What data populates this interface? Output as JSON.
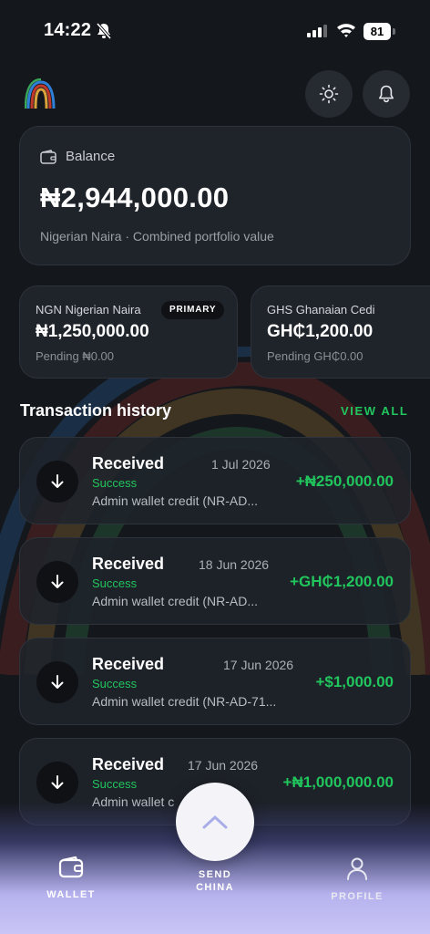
{
  "status_bar": {
    "time": "14:22",
    "battery": "81"
  },
  "balance": {
    "label": "Balance",
    "amount": "₦2,944,000.00",
    "subtitle": "Nigerian Naira · Combined portfolio value"
  },
  "currencies": [
    {
      "name": "NGN Nigerian Naira",
      "badge": "PRIMARY",
      "amount": "₦1,250,000.00",
      "pending": "Pending ₦0.00"
    },
    {
      "name": "GHS Ghanaian Cedi",
      "amount": "GH₵1,200.00",
      "pending": "Pending GH₵0.00"
    }
  ],
  "transactions_header": {
    "title": "Transaction history",
    "view_all": "VIEW ALL"
  },
  "transactions": [
    {
      "type": "Received",
      "date": "1 Jul 2026",
      "status": "Success",
      "description": "Admin wallet credit (NR-AD...",
      "amount": "+₦250,000.00"
    },
    {
      "type": "Received",
      "date": "18 Jun 2026",
      "status": "Success",
      "description": "Admin wallet credit (NR-AD...",
      "amount": "+GH₵1,200.00"
    },
    {
      "type": "Received",
      "date": "17 Jun 2026",
      "status": "Success",
      "description": "Admin wallet credit (NR-AD-71...",
      "amount": "+$1,000.00"
    },
    {
      "type": "Received",
      "date": "17 Jun 2026",
      "status": "Success",
      "description": "Admin wallet c",
      "amount": "+₦1,000,000.00"
    }
  ],
  "bottom_nav": {
    "wallet": "WALLET",
    "send": "SEND\nCHINA",
    "profile": "PROFILE"
  },
  "colors": {
    "background": "#14171c",
    "card": "#1f232a",
    "success": "#21c55d",
    "nav_gradient_end": "#c9c6f6"
  }
}
